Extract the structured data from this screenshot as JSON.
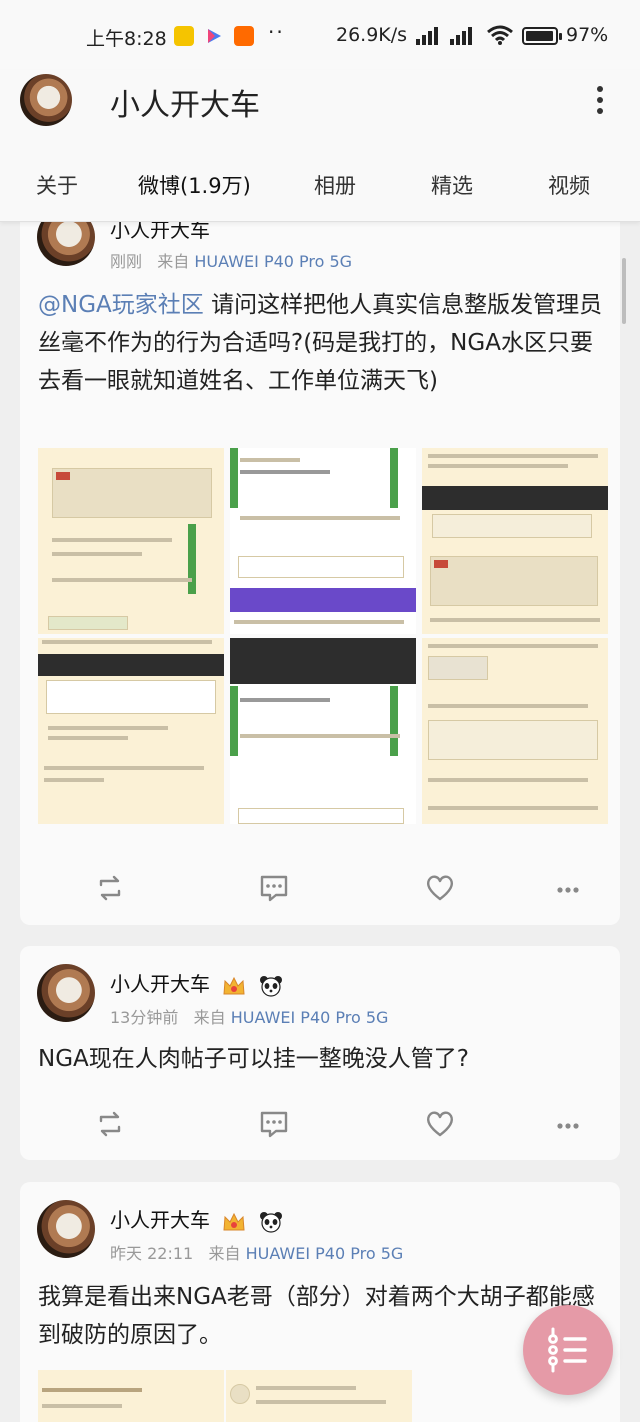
{
  "status_bar": {
    "time": "上午8:28",
    "dots": "··",
    "speed": "26.9K/s",
    "battery_pct": "97%",
    "battery_level": 0.97
  },
  "header": {
    "title": "小人开大车"
  },
  "tabs": [
    {
      "label": "关于"
    },
    {
      "label": "微博(1.9万)",
      "active": true
    },
    {
      "label": "相册"
    },
    {
      "label": "精选"
    },
    {
      "label": "视频"
    }
  ],
  "posts": [
    {
      "author": "小人开大车",
      "time": "刚刚",
      "source_prefix": "来自",
      "device": "HUAWEI P40 Pro 5G",
      "mention": "@NGA玩家社区",
      "text": " 请问这样把他人真实信息整版发管理员丝毫不作为的行为合适吗?(码是我打的，NGA水区只要去看一眼就知道姓名、工作单位满天飞)"
    },
    {
      "author": "小人开大车",
      "time": "13分钟前",
      "source_prefix": "来自",
      "device": "HUAWEI P40 Pro 5G",
      "text": "NGA现在人肉帖子可以挂一整晚没人管了?"
    },
    {
      "author": "小人开大车",
      "time": "昨天 22:11",
      "source_prefix": "来自",
      "device": "HUAWEI P40 Pro 5G",
      "text": "我算是看出来NGA老哥（部分）对着两个大胡子都能感到破防的原因了。"
    }
  ],
  "colors": {
    "link": "#5b7fb5",
    "fab": "#e59aa7",
    "meta": "#999999"
  }
}
